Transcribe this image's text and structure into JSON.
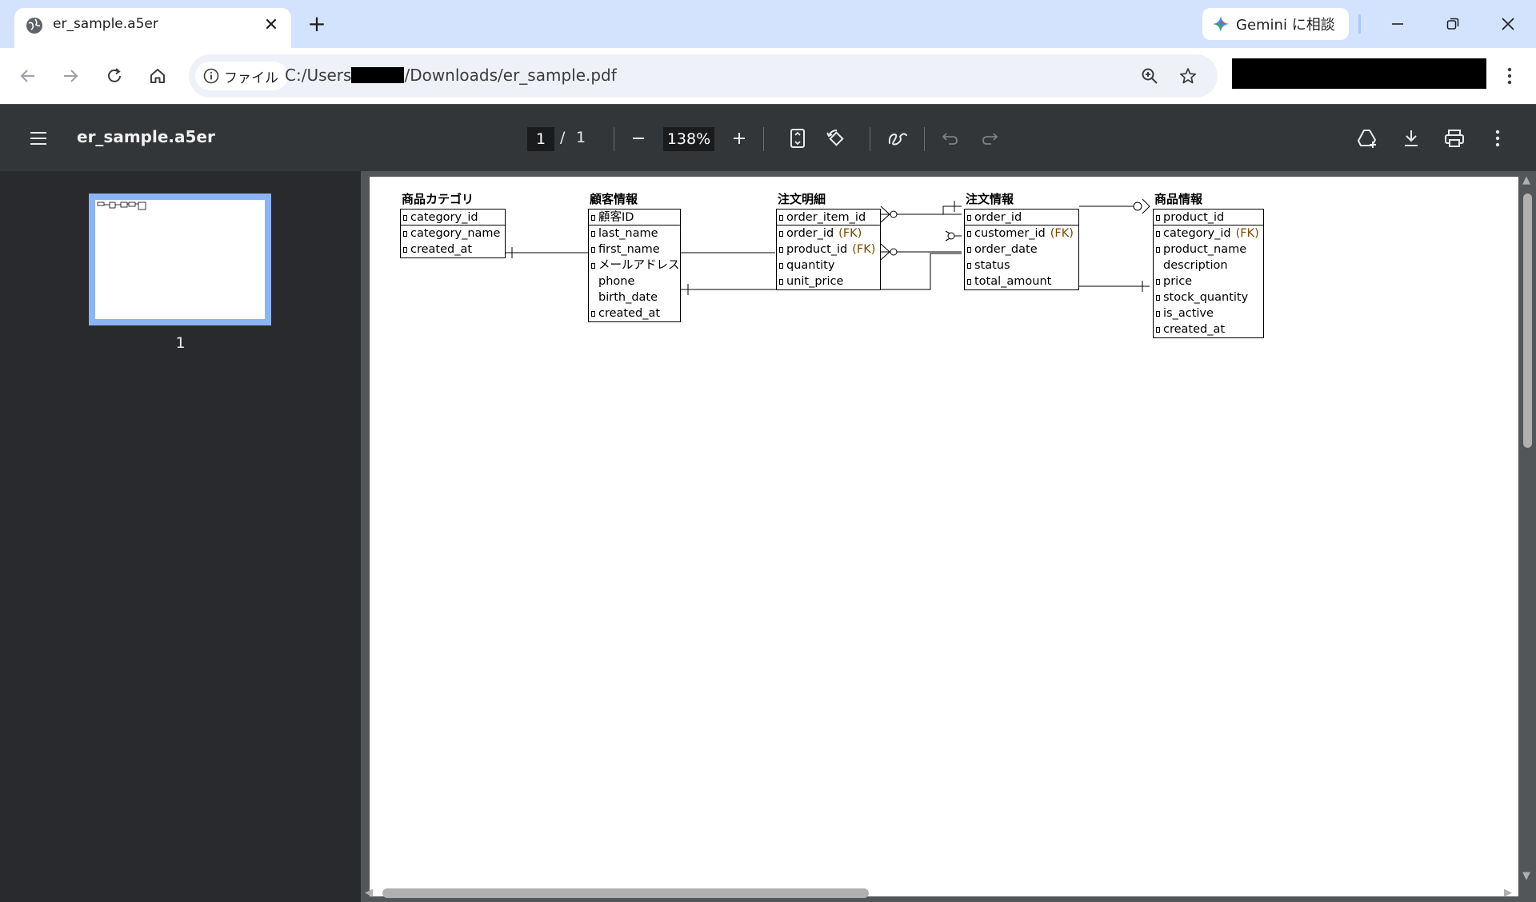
{
  "browser": {
    "tab_title": "er_sample.a5er",
    "tab_close": "✕",
    "new_tab": "+",
    "gemini_label": "Gemini に相談",
    "site_chip_label": "ファイル",
    "url_prefix": "C:/Users",
    "url_suffix": "/Downloads/er_sample.pdf"
  },
  "pdf_toolbar": {
    "title": "er_sample.a5er",
    "page_current": "1",
    "page_separator": "/",
    "page_total": "1",
    "zoom": "138%"
  },
  "sidebar": {
    "thumbnail_page_label": "1"
  },
  "diagram": {
    "entities": [
      {
        "title": "商品カテゴリ",
        "pk_rows": [
          {
            "name": "category_id",
            "fk": ""
          }
        ],
        "rows": [
          {
            "name": "category_name",
            "fk": "",
            "key": true
          },
          {
            "name": "created_at",
            "fk": "",
            "key": true
          }
        ]
      },
      {
        "title": "顧客情報",
        "pk_rows": [
          {
            "name": "顧客ID",
            "fk": ""
          }
        ],
        "rows": [
          {
            "name": "last_name",
            "fk": "",
            "key": true
          },
          {
            "name": "first_name",
            "fk": "",
            "key": true
          },
          {
            "name": "メールアドレス",
            "fk": "",
            "key": true
          },
          {
            "name": "phone",
            "fk": "",
            "key": false
          },
          {
            "name": "birth_date",
            "fk": "",
            "key": false
          },
          {
            "name": "created_at",
            "fk": "",
            "key": true
          }
        ]
      },
      {
        "title": "注文明細",
        "pk_rows": [
          {
            "name": "order_item_id",
            "fk": ""
          }
        ],
        "rows": [
          {
            "name": "order_id",
            "fk": "(FK)",
            "key": true
          },
          {
            "name": "product_id",
            "fk": "(FK)",
            "key": true
          },
          {
            "name": "quantity",
            "fk": "",
            "key": true
          },
          {
            "name": "unit_price",
            "fk": "",
            "key": true
          }
        ]
      },
      {
        "title": "注文情報",
        "pk_rows": [
          {
            "name": "order_id",
            "fk": ""
          }
        ],
        "rows": [
          {
            "name": "customer_id",
            "fk": "(FK)",
            "key": true
          },
          {
            "name": "order_date",
            "fk": "",
            "key": true
          },
          {
            "name": "status",
            "fk": "",
            "key": true
          },
          {
            "name": "total_amount",
            "fk": "",
            "key": true
          }
        ]
      },
      {
        "title": "商品情報",
        "pk_rows": [
          {
            "name": "product_id",
            "fk": ""
          }
        ],
        "rows": [
          {
            "name": "category_id",
            "fk": "(FK)",
            "key": true
          },
          {
            "name": "product_name",
            "fk": "",
            "key": true
          },
          {
            "name": "description",
            "fk": "",
            "key": false
          },
          {
            "name": "price",
            "fk": "",
            "key": true
          },
          {
            "name": "stock_quantity",
            "fk": "",
            "key": true
          },
          {
            "name": "is_active",
            "fk": "",
            "key": true
          },
          {
            "name": "created_at",
            "fk": "",
            "key": true
          }
        ]
      }
    ]
  },
  "colors": {
    "tabstrip": "#d3e3fd",
    "pdf_toolbar": "#323639",
    "sidebar": "#282a2d",
    "doc_background": "#525659",
    "thumbnail_border": "#8ab4f8",
    "fk_text": "#7a4a00"
  }
}
